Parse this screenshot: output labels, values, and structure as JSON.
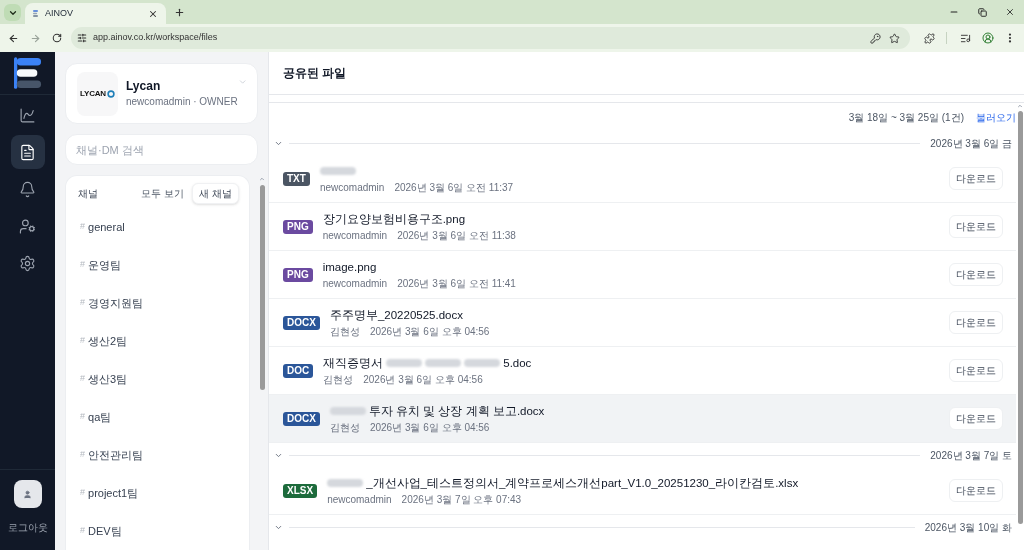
{
  "browser": {
    "tab": {
      "title": "AINOV",
      "selected": true
    },
    "url": "app.ainov.co.kr/workspace/files"
  },
  "nav_rail": {
    "items": [
      {
        "selected": false
      },
      {
        "selected": true
      },
      {
        "selected": false
      },
      {
        "selected": false
      },
      {
        "selected": false
      }
    ],
    "logout": "로그아웃"
  },
  "workspace": {
    "logo_text": "LYCAN",
    "name": "Lycan",
    "user": "newcomadmin · OWNER"
  },
  "search": {
    "placeholder": "채널·DM 검색"
  },
  "channels": {
    "title": "채널",
    "view_all": "모두 보기",
    "new_button": "새 채널",
    "items": [
      {
        "hash": "#",
        "name": "general"
      },
      {
        "hash": "#",
        "name": "운영팀"
      },
      {
        "hash": "#",
        "name": "경영지원팀"
      },
      {
        "hash": "#",
        "name": "생산2팀"
      },
      {
        "hash": "#",
        "name": "생산3팀"
      },
      {
        "hash": "#",
        "name": "qa팀"
      },
      {
        "hash": "#",
        "name": "안전관리팀"
      },
      {
        "hash": "#",
        "name": "project1팀"
      },
      {
        "hash": "#",
        "name": "DEV팀"
      }
    ]
  },
  "files": {
    "title": "공유된 파일",
    "range": "3월 18일 ~ 3월 25일 (1건)",
    "load_button": "불러오기",
    "groups": [
      {
        "date": "2026년 3월 6일 금",
        "expanded": true,
        "files": [
          {
            "type": "TXT",
            "color": "#4b5563",
            "name_parts": [
              {
                "kind": "redacted"
              }
            ],
            "uploader": "newcomadmin",
            "time": "2026년 3월 6일 오전 11:37",
            "download": "다운로드",
            "highlighted": false
          },
          {
            "type": "PNG",
            "color": "#6b4aa0",
            "name_parts": [
              {
                "kind": "text",
                "text": "장기요양보험비용구조.png"
              }
            ],
            "uploader": "newcomadmin",
            "time": "2026년 3월 6일 오전 11:38",
            "download": "다운로드",
            "highlighted": false
          },
          {
            "type": "PNG",
            "color": "#6b4aa0",
            "name_parts": [
              {
                "kind": "text",
                "text": "image.png"
              }
            ],
            "uploader": "newcomadmin",
            "time": "2026년 3월 6일 오전 11:41",
            "download": "다운로드",
            "highlighted": false
          },
          {
            "type": "DOCX",
            "color": "#2b5699",
            "name_parts": [
              {
                "kind": "text",
                "text": "주주명부_20220525.docx"
              }
            ],
            "uploader": "김현성",
            "time": "2026년 3월 6일 오후 04:56",
            "download": "다운로드",
            "highlighted": false
          },
          {
            "type": "DOC",
            "color": "#2b5699",
            "name_parts": [
              {
                "kind": "text",
                "text": "재직증명서"
              },
              {
                "kind": "redacted"
              },
              {
                "kind": "redacted"
              },
              {
                "kind": "redacted"
              },
              {
                "kind": "text",
                "text": "5.doc"
              }
            ],
            "uploader": "김현성",
            "time": "2026년 3월 6일 오후 04:56",
            "download": "다운로드",
            "highlighted": false
          },
          {
            "type": "DOCX",
            "color": "#2b5699",
            "name_parts": [
              {
                "kind": "redacted"
              },
              {
                "kind": "text",
                "text": "투자 유치 및 상장 계획 보고.docx"
              }
            ],
            "uploader": "김현성",
            "time": "2026년 3월 6일 오후 04:56",
            "download": "다운로드",
            "highlighted": true
          }
        ]
      },
      {
        "date": "2026년 3월 7일 토",
        "expanded": true,
        "files": [
          {
            "type": "XLSX",
            "color": "#1d6b3c",
            "name_parts": [
              {
                "kind": "redacted"
              },
              {
                "kind": "text",
                "text": "_개선사업_테스트정의서_계약프로세스개선part_V1.0_20251230_라이칸검토.xlsx"
              }
            ],
            "uploader": "newcomadmin",
            "time": "2026년 3월 7일 오후 07:43",
            "download": "다운로드",
            "highlighted": false
          }
        ]
      },
      {
        "date": "2026년 3월 10일 화",
        "expanded": true
      }
    ]
  }
}
